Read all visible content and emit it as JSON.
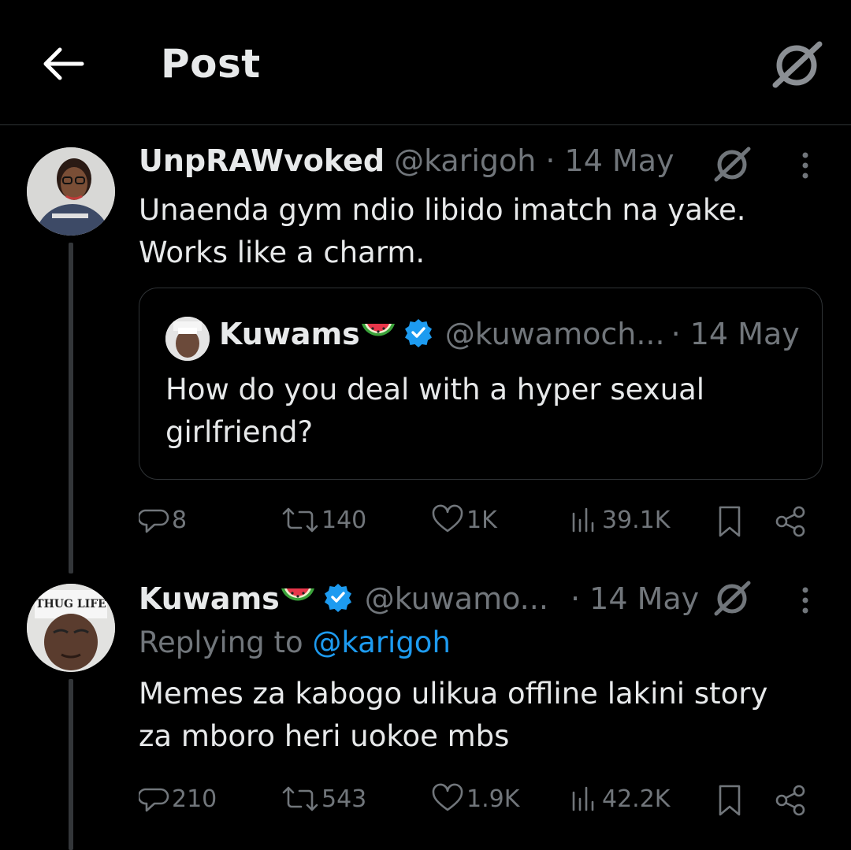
{
  "header": {
    "title": "Post"
  },
  "tweet1": {
    "display_name": "UnpRAWvoked",
    "handle": "@karigoh",
    "date": "· 14 May",
    "text": "Unaenda gym ndio libido imatch na yake. Works like a charm.",
    "quote": {
      "display_name": "Kuwams",
      "handle": "@kuwamoch...",
      "date": "· 14 May",
      "text": "How do you deal with a hyper sexual girlfriend?"
    },
    "stats": {
      "replies": "8",
      "reposts": "140",
      "likes": "1K",
      "views": "39.1K"
    }
  },
  "tweet2": {
    "display_name": "Kuwams",
    "handle": "@kuwamo...",
    "date": "· 14 May",
    "replying_prefix": "Replying to",
    "replying_to": "@karigoh",
    "text": "Memes za kabogo ulikua offline lakini story za mboro heri uokoe mbs",
    "avatar_text": "THUG LIFE",
    "stats": {
      "replies": "210",
      "reposts": "543",
      "likes": "1.9K",
      "views": "42.2K"
    }
  },
  "colors": {
    "background": "#000000",
    "text": "#e7e9ea",
    "muted": "#71767b",
    "accent": "#1d9bf0",
    "divider": "#2f3336"
  },
  "icons": [
    "back-arrow-icon",
    "grok-icon",
    "more-icon",
    "verified-badge-icon",
    "watermelon-emoji-icon",
    "reply-icon",
    "repost-icon",
    "like-icon",
    "views-icon",
    "bookmark-icon",
    "share-icon"
  ]
}
